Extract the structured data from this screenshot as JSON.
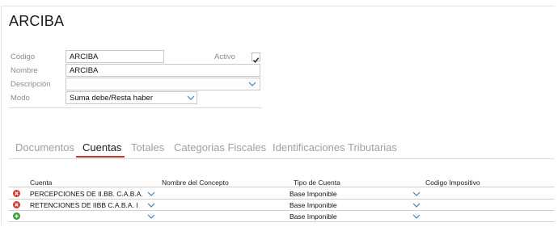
{
  "page": {
    "title": "ARCIBA"
  },
  "form": {
    "codigo": {
      "label": "Código",
      "value": "ARCIBA"
    },
    "activo": {
      "label": "Activo",
      "checked": true
    },
    "nombre": {
      "label": "Nombre",
      "value": "ARCIBA"
    },
    "descripcion": {
      "label": "Descripción",
      "value": ""
    },
    "modo": {
      "label": "Modo",
      "value": "Suma debe/Resta haber"
    }
  },
  "tabs": [
    {
      "label": "Documentos",
      "active": false
    },
    {
      "label": "Cuentas",
      "active": true
    },
    {
      "label": "Totales",
      "active": false
    },
    {
      "label": "Categorias Fiscales",
      "active": false
    },
    {
      "label": "Identificaciones Tributarias",
      "active": false
    }
  ],
  "grid": {
    "columns": [
      "Cuenta",
      "Nombre del Concepto",
      "Tipo de Cuenta",
      "Codigo Impositivo"
    ],
    "rows": [
      {
        "action": "remove-icon",
        "cuenta": "PERCEPCIONES DE II.BB. C.A.B.A.",
        "nombre_concepto": "",
        "tipo_cuenta": "Base Imponible",
        "codigo_impositivo": ""
      },
      {
        "action": "remove-icon",
        "cuenta": "RETENCIONES DE IIBB C.A.B.A. I",
        "nombre_concepto": "",
        "tipo_cuenta": "Base Imponible",
        "codigo_impositivo": ""
      },
      {
        "action": "add-icon",
        "cuenta": "",
        "nombre_concepto": "",
        "tipo_cuenta": "Base Imponible",
        "codigo_impositivo": ""
      }
    ]
  },
  "colors": {
    "accent": "#c0392b",
    "remove": "#d63a2f",
    "add": "#3d9b2f",
    "chevron": "#4a7fc1"
  }
}
